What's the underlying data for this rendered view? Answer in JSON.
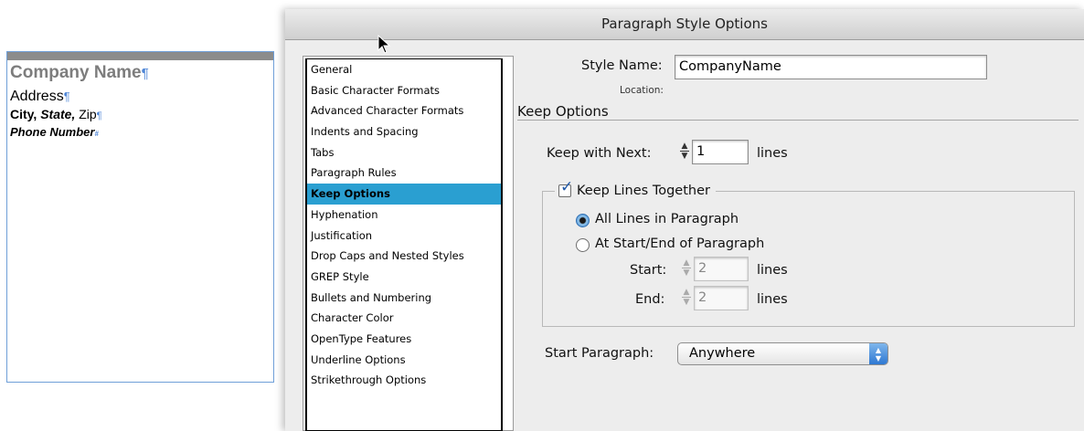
{
  "document": {
    "company_name": "Company Name",
    "address": "Address",
    "city_state_zip": {
      "city": "City,",
      "state": "State,",
      "zip": "Zip"
    },
    "phone": "Phone Number"
  },
  "dialog": {
    "title": "Paragraph Style Options",
    "categories": [
      "General",
      "Basic Character Formats",
      "Advanced Character Formats",
      "Indents and Spacing",
      "Tabs",
      "Paragraph Rules",
      "Keep Options",
      "Hyphenation",
      "Justification",
      "Drop Caps and Nested Styles",
      "GREP Style",
      "Bullets and Numbering",
      "Character Color",
      "OpenType Features",
      "Underline Options",
      "Strikethrough Options"
    ],
    "selected_category": "Keep Options",
    "style_name_label": "Style Name:",
    "style_name_value": "CompanyName",
    "location_label": "Location:",
    "section_title": "Keep Options",
    "keep_with_next": {
      "label": "Keep with Next:",
      "value": "1",
      "unit": "lines"
    },
    "keep_lines_together": {
      "label": "Keep Lines Together",
      "checked": true,
      "options": [
        "All Lines in Paragraph",
        "At Start/End of Paragraph"
      ],
      "selected_option": "All Lines in Paragraph",
      "start": {
        "label": "Start:",
        "value": "2",
        "unit": "lines"
      },
      "end": {
        "label": "End:",
        "value": "2",
        "unit": "lines"
      }
    },
    "start_paragraph": {
      "label": "Start Paragraph:",
      "value": "Anywhere"
    }
  }
}
